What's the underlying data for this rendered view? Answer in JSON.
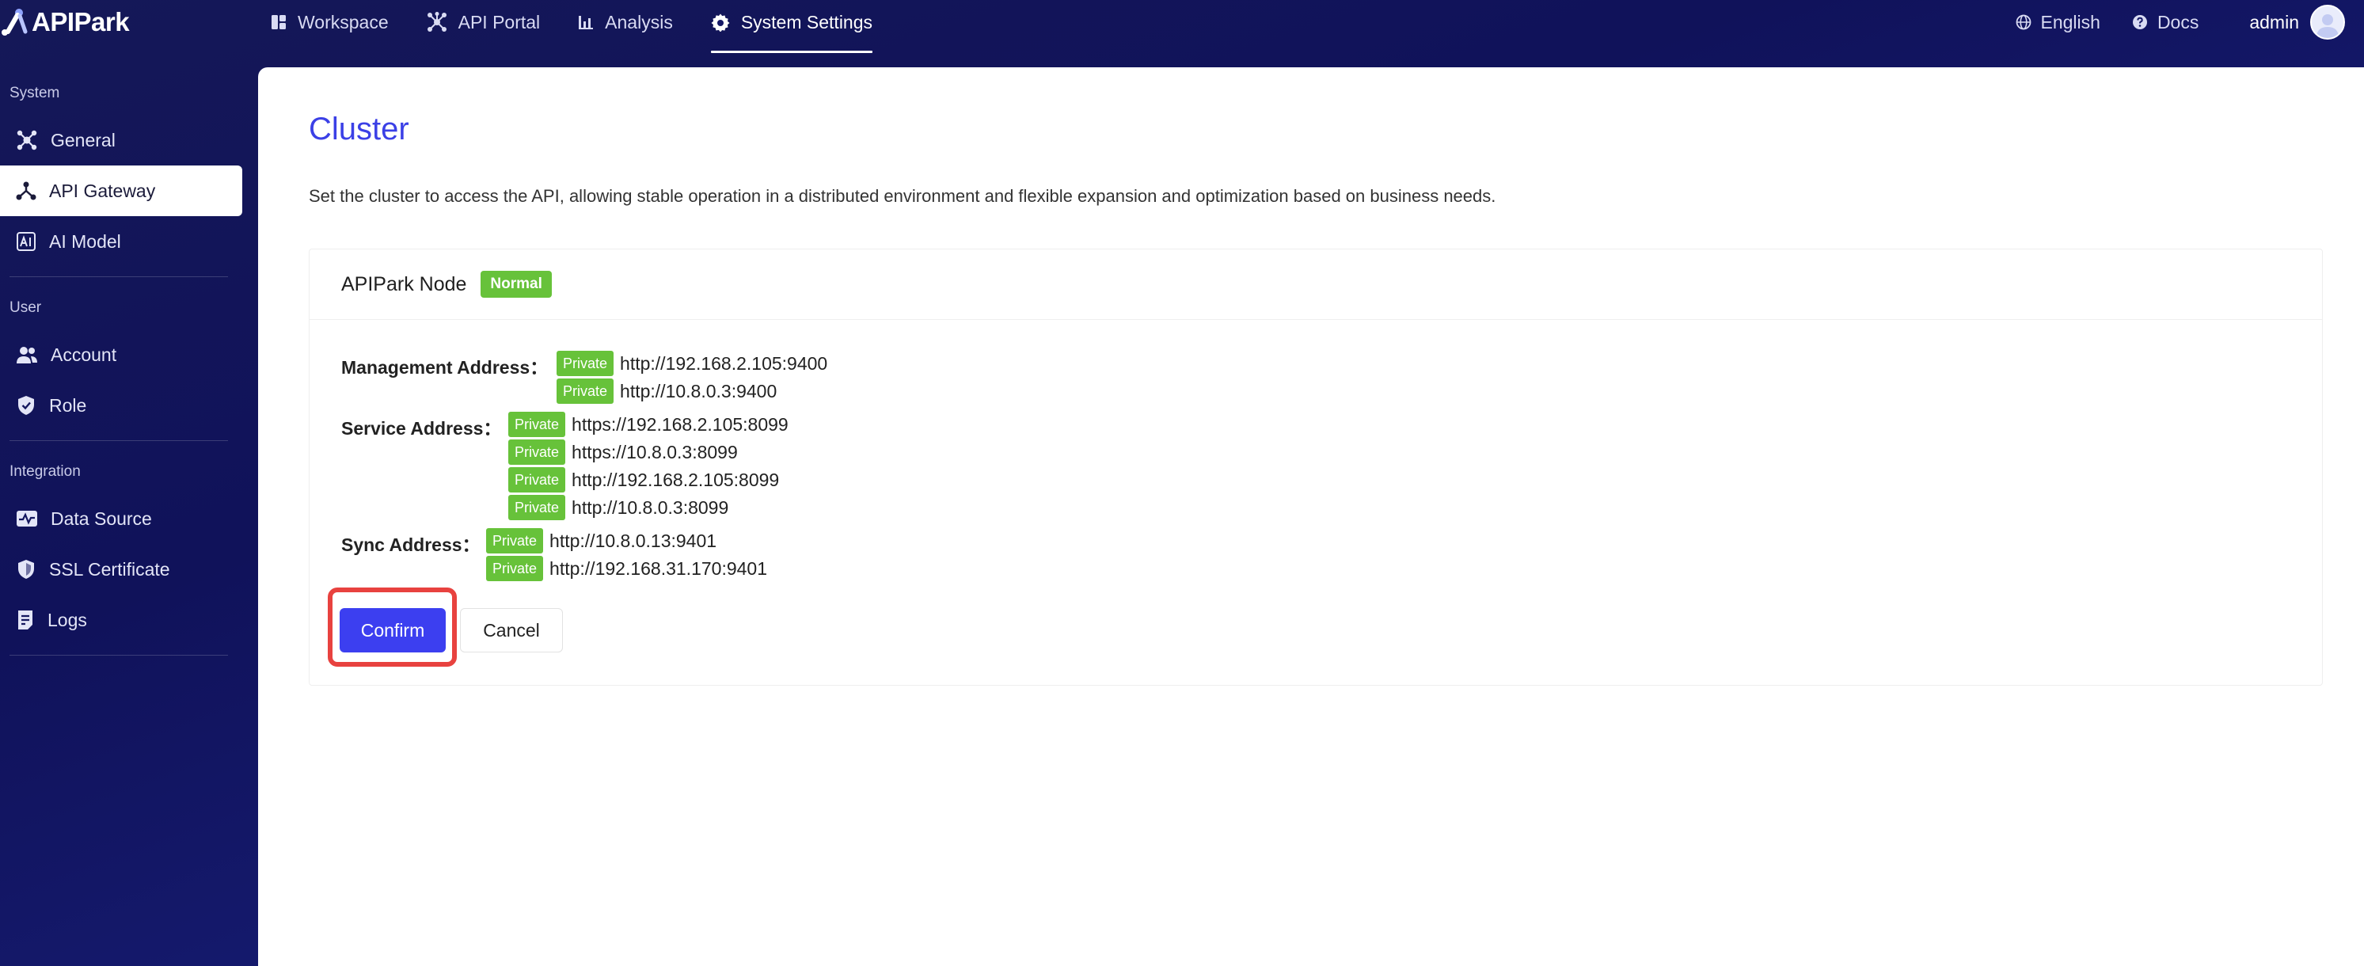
{
  "app": {
    "name": "APIPark"
  },
  "nav": {
    "items": [
      {
        "label": "Workspace",
        "icon": "workspace-icon",
        "active": false
      },
      {
        "label": "API Portal",
        "icon": "api-portal-icon",
        "active": false
      },
      {
        "label": "Analysis",
        "icon": "analysis-icon",
        "active": false
      },
      {
        "label": "System Settings",
        "icon": "gear-icon",
        "active": true
      }
    ]
  },
  "top_right": {
    "language": "English",
    "docs": "Docs",
    "user": "admin"
  },
  "sidebar": {
    "groups": [
      {
        "title": "System",
        "items": [
          {
            "label": "General",
            "icon": "general-icon",
            "active": false
          },
          {
            "label": "API Gateway",
            "icon": "api-gateway-icon",
            "active": true
          },
          {
            "label": "AI Model",
            "icon": "ai-model-icon",
            "active": false
          }
        ]
      },
      {
        "title": "User",
        "items": [
          {
            "label": "Account",
            "icon": "account-icon",
            "active": false
          },
          {
            "label": "Role",
            "icon": "role-icon",
            "active": false
          }
        ]
      },
      {
        "title": "Integration",
        "items": [
          {
            "label": "Data Source",
            "icon": "data-source-icon",
            "active": false
          },
          {
            "label": "SSL Certificate",
            "icon": "ssl-certificate-icon",
            "active": false
          },
          {
            "label": "Logs",
            "icon": "logs-icon",
            "active": false
          }
        ]
      }
    ]
  },
  "page": {
    "title": "Cluster",
    "description": "Set the cluster to access the API, allowing stable operation in a distributed environment and flexible expansion and optimization based on business needs."
  },
  "node": {
    "title": "APIPark Node",
    "status": "Normal",
    "management": {
      "label": "Management Address：",
      "addresses": [
        {
          "tag": "Private",
          "url": "http://192.168.2.105:9400"
        },
        {
          "tag": "Private",
          "url": "http://10.8.0.3:9400"
        }
      ]
    },
    "service": {
      "label": "Service Address：",
      "addresses": [
        {
          "tag": "Private",
          "url": "https://192.168.2.105:8099"
        },
        {
          "tag": "Private",
          "url": "https://10.8.0.3:8099"
        },
        {
          "tag": "Private",
          "url": "http://192.168.2.105:8099"
        },
        {
          "tag": "Private",
          "url": "http://10.8.0.3:8099"
        }
      ]
    },
    "sync": {
      "label": "Sync Address：",
      "addresses": [
        {
          "tag": "Private",
          "url": "http://10.8.0.13:9401"
        },
        {
          "tag": "Private",
          "url": "http://192.168.31.170:9401"
        }
      ]
    }
  },
  "actions": {
    "confirm": "Confirm",
    "cancel": "Cancel"
  },
  "colors": {
    "accent": "#3c3ff0",
    "title": "#3b40e6",
    "tag_green": "#67c23a",
    "highlight_red": "#e8423f",
    "sidebar_bg": "#14175e"
  }
}
